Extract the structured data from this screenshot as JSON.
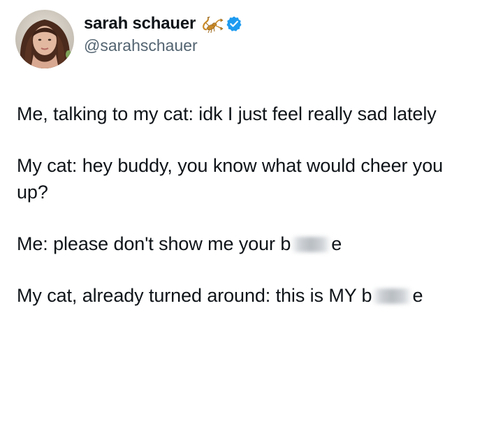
{
  "author": {
    "display_name": "sarah schauer",
    "handle": "@sarahschauer",
    "name_emoji_icon": "scorpion-icon",
    "verified_icon": "verified-badge-icon",
    "verified_color": "#1d9bf0"
  },
  "tweet": {
    "line1_text": "Me, talking to my cat: idk I just feel really sad lately",
    "line2_text": "My cat: hey buddy, you know what would cheer you up?",
    "line3_prefix": "Me: please don't show me your b",
    "line3_suffix": "e",
    "line4_prefix": "My cat, already turned around: this is MY b",
    "line4_suffix": "e"
  },
  "colors": {
    "text": "#0f1419",
    "secondary_text": "#536471",
    "background": "#ffffff"
  }
}
